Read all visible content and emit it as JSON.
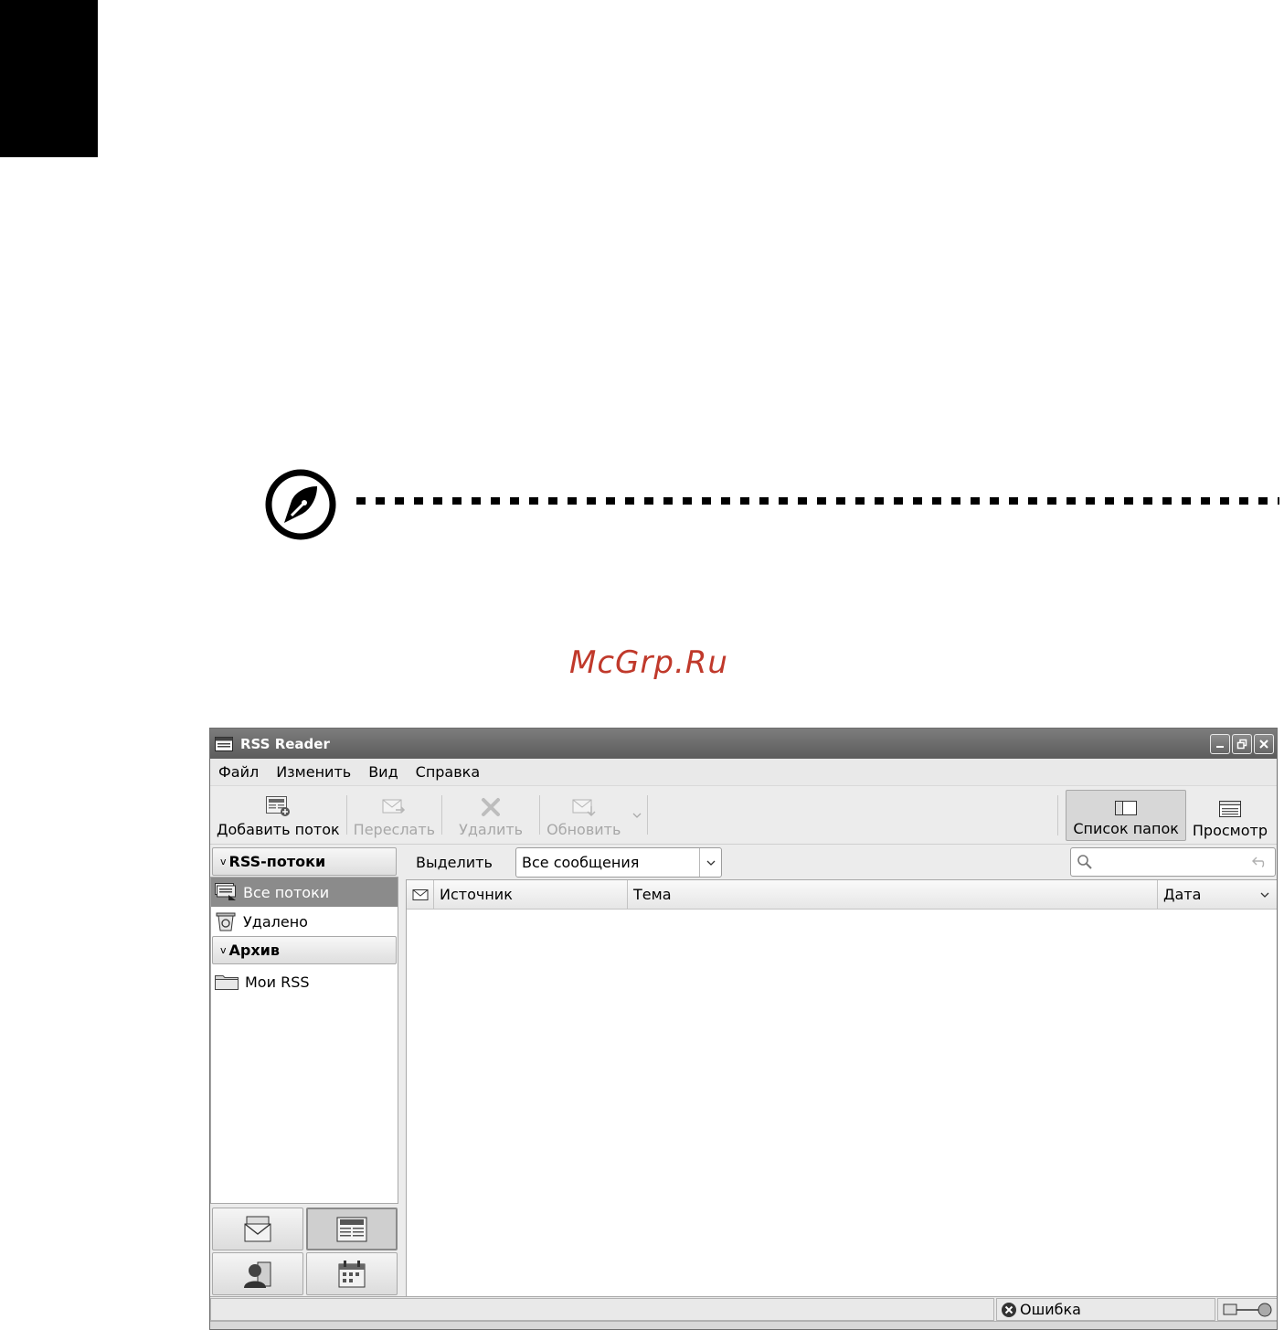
{
  "watermark": "McGrp.Ru",
  "window": {
    "title": "RSS Reader"
  },
  "menu": [
    "Файл",
    "Изменить",
    "Вид",
    "Справка"
  ],
  "toolbar": {
    "add_feed": "Добавить поток",
    "forward": "Переслать",
    "delete": "Удалить",
    "refresh": "Обновить",
    "folder_list": "Список папок",
    "preview": "Просмотр"
  },
  "sidebar": {
    "section_feeds": "RSS-потоки",
    "all_feeds": "Все потоки",
    "deleted": "Удалено",
    "section_archive": "Архив",
    "my_rss": "Мои RSS"
  },
  "filter": {
    "label": "Выделить",
    "selected": "Все сообщения"
  },
  "columns": {
    "source": "Источник",
    "subject": "Тема",
    "date": "Дата"
  },
  "status": {
    "error": "Ошибка"
  }
}
